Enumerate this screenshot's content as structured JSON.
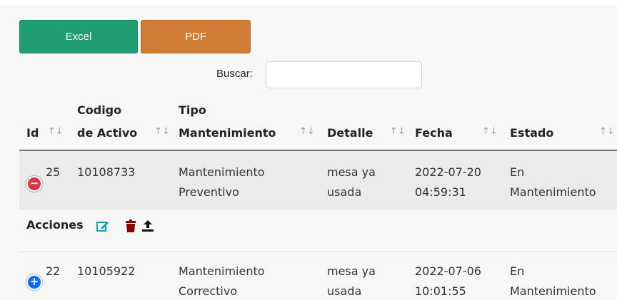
{
  "toolbar": {
    "excel_label": "Excel",
    "pdf_label": "PDF",
    "search_label": "Buscar:",
    "search_value": ""
  },
  "table": {
    "headers": [
      {
        "line1": "",
        "line2": "Id"
      },
      {
        "line1": "Codigo",
        "line2": "de Activo"
      },
      {
        "line1": "Tipo",
        "line2": "Mantenimiento"
      },
      {
        "line1": "",
        "line2": "Detalle"
      },
      {
        "line1": "",
        "line2": "Fecha"
      },
      {
        "line1": "",
        "line2": "Estado"
      }
    ],
    "sort_glyph": "↑↓",
    "rows": [
      {
        "id": "25",
        "codigo": "10108733",
        "tipo1": "Mantenimiento",
        "tipo2": "Preventivo",
        "detalle1": "mesa ya",
        "detalle2": "usada",
        "fecha1": "2022-07-20",
        "fecha2": "04:59:31",
        "estado1": "En",
        "estado2": "Mantenimiento",
        "toggle": "−"
      },
      {
        "id": "22",
        "codigo": "10105922",
        "tipo1": "Mantenimiento",
        "tipo2": "Correctivo",
        "detalle1": "mesa ya",
        "detalle2": "usada",
        "fecha1": "2022-07-06",
        "fecha2": "10:01:55",
        "estado1": "En",
        "estado2": "Mantenimiento",
        "toggle": "+"
      }
    ],
    "child": {
      "label": "Acciones",
      "icons": [
        "edit-icon",
        "trash-icon",
        "upload-icon"
      ]
    }
  },
  "colors": {
    "excel": "#1f9d73",
    "pdf": "#d07e37",
    "minus": "#dc3545",
    "plus": "#0d6efd",
    "edit": "#17a2b8",
    "trash": "#8b0000"
  }
}
